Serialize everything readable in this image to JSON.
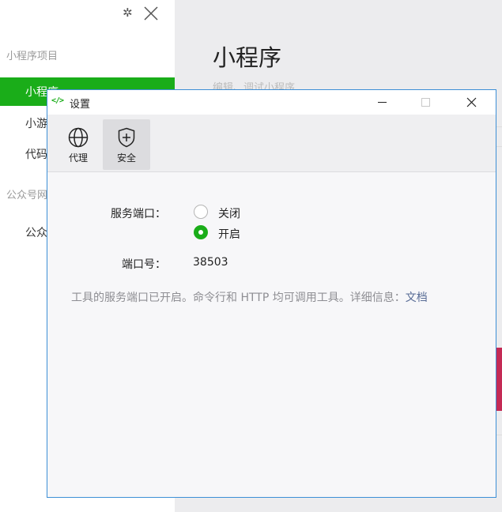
{
  "background": {
    "section_miniprogram": "小程序项目",
    "item_selected": "小程序",
    "item_game": "小游",
    "item_code": "代码",
    "section_official": "公众号网",
    "item_official": "公众",
    "main_title": "小程序",
    "main_subtitle": "编辑、调试小程序"
  },
  "dialog": {
    "title": "设置",
    "toolbar": [
      {
        "label": "代理",
        "icon": "globe-icon"
      },
      {
        "label": "安全",
        "icon": "shield-icon"
      }
    ],
    "service_port": {
      "label": "服务端口：",
      "options": [
        {
          "label": "关闭",
          "checked": false
        },
        {
          "label": "开启",
          "checked": true
        }
      ]
    },
    "port_number": {
      "label": "端口号：",
      "value": "38503"
    },
    "info_text": "工具的服务端口已开启。命令行和 HTTP 均可调用工具。详细信息：",
    "info_link": "文档"
  },
  "colors": {
    "accent": "#1aad19",
    "dialog_border": "#3d8fd6",
    "link": "#576b95"
  }
}
